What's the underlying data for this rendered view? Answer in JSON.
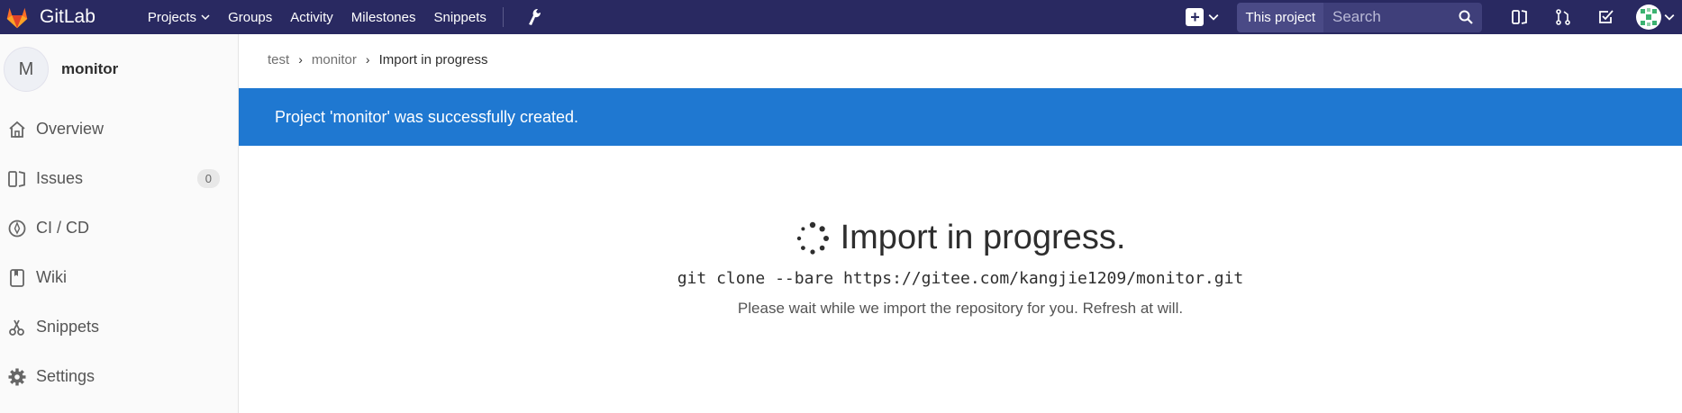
{
  "brand": {
    "name": "GitLab"
  },
  "top_nav": {
    "links": [
      {
        "label": "Projects",
        "has_dropdown": true
      },
      {
        "label": "Groups"
      },
      {
        "label": "Activity"
      },
      {
        "label": "Milestones"
      },
      {
        "label": "Snippets"
      }
    ],
    "search": {
      "scope": "This project",
      "placeholder": "Search"
    }
  },
  "sidebar": {
    "project_initial": "M",
    "project_name": "monitor",
    "items": [
      {
        "label": "Overview",
        "icon": "home-icon"
      },
      {
        "label": "Issues",
        "icon": "issues-icon",
        "count": "0"
      },
      {
        "label": "CI / CD",
        "icon": "rocket-icon"
      },
      {
        "label": "Wiki",
        "icon": "book-icon"
      },
      {
        "label": "Snippets",
        "icon": "scissors-icon"
      },
      {
        "label": "Settings",
        "icon": "gear-icon"
      }
    ]
  },
  "breadcrumb": [
    "test",
    "monitor",
    "Import in progress"
  ],
  "flash": {
    "message": "Project 'monitor' was successfully created."
  },
  "import": {
    "title": "Import in progress.",
    "command": "git clone --bare https://gitee.com/kangjie1209/monitor.git",
    "note": "Please wait while we import the repository for you. Refresh at will."
  },
  "colors": {
    "nav_bg": "#292961",
    "flash_bg": "#1f78d1",
    "sidebar_bg": "#fafafa"
  }
}
